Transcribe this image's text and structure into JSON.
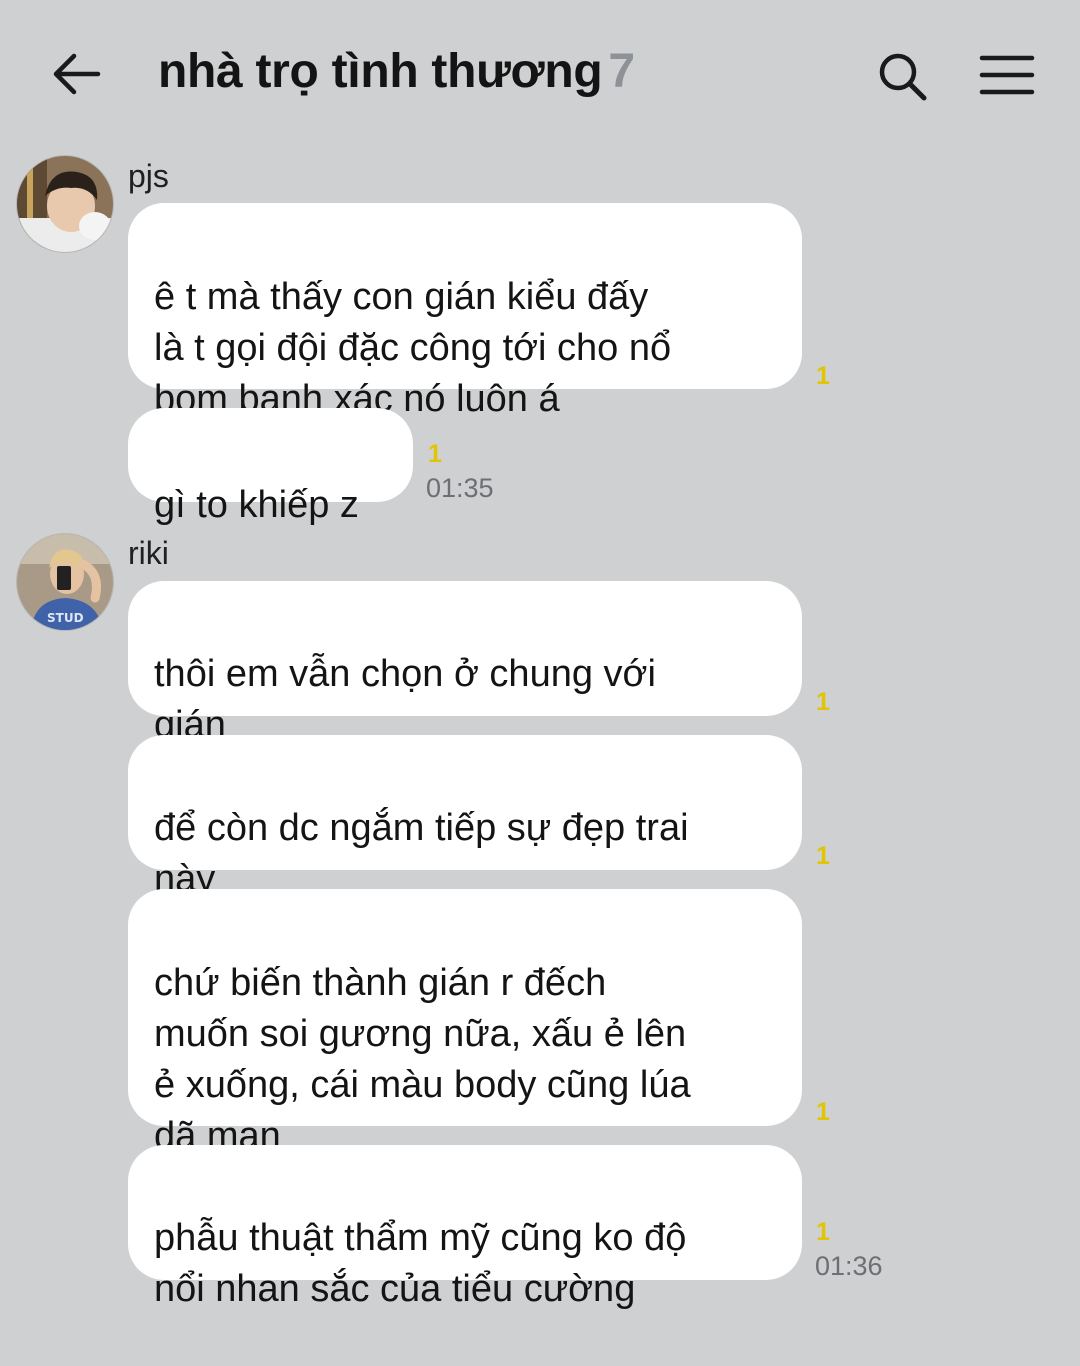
{
  "header": {
    "title": "nhà trọ tình thương",
    "member_count": "7"
  },
  "groups": [
    {
      "sender": "pjs",
      "messages": [
        {
          "text": "ê t mà thấy con gián kiểu đấy\nlà t gọi đội đặc công tới cho nổ\nbom banh xác nó luôn á",
          "unread": "1",
          "time": ""
        },
        {
          "text": "gì to khiếp z",
          "unread": "1",
          "time": "01:35"
        }
      ]
    },
    {
      "sender": "riki",
      "messages": [
        {
          "text": "thôi em vẫn chọn ở chung với\ngián",
          "unread": "1",
          "time": ""
        },
        {
          "text": "để còn dc ngắm tiếp sự đẹp trai\nnày",
          "unread": "1",
          "time": ""
        },
        {
          "text": "chứ biến thành gián r đếch\nmuốn soi gương nữa, xấu ẻ lên\nẻ xuống, cái màu body cũng lúa\ndã man",
          "unread": "1",
          "time": ""
        },
        {
          "text": "phẫu thuật thẩm mỹ cũng ko độ\nnổi nhan sắc của tiểu cường",
          "unread": "1",
          "time": "01:36"
        }
      ]
    }
  ],
  "colors": {
    "background": "#cfd0d2",
    "bubble": "#ffffff",
    "unread": "#e2c400",
    "count": "#8e9296"
  },
  "icons": [
    "back-arrow-icon",
    "search-icon",
    "menu-icon"
  ]
}
